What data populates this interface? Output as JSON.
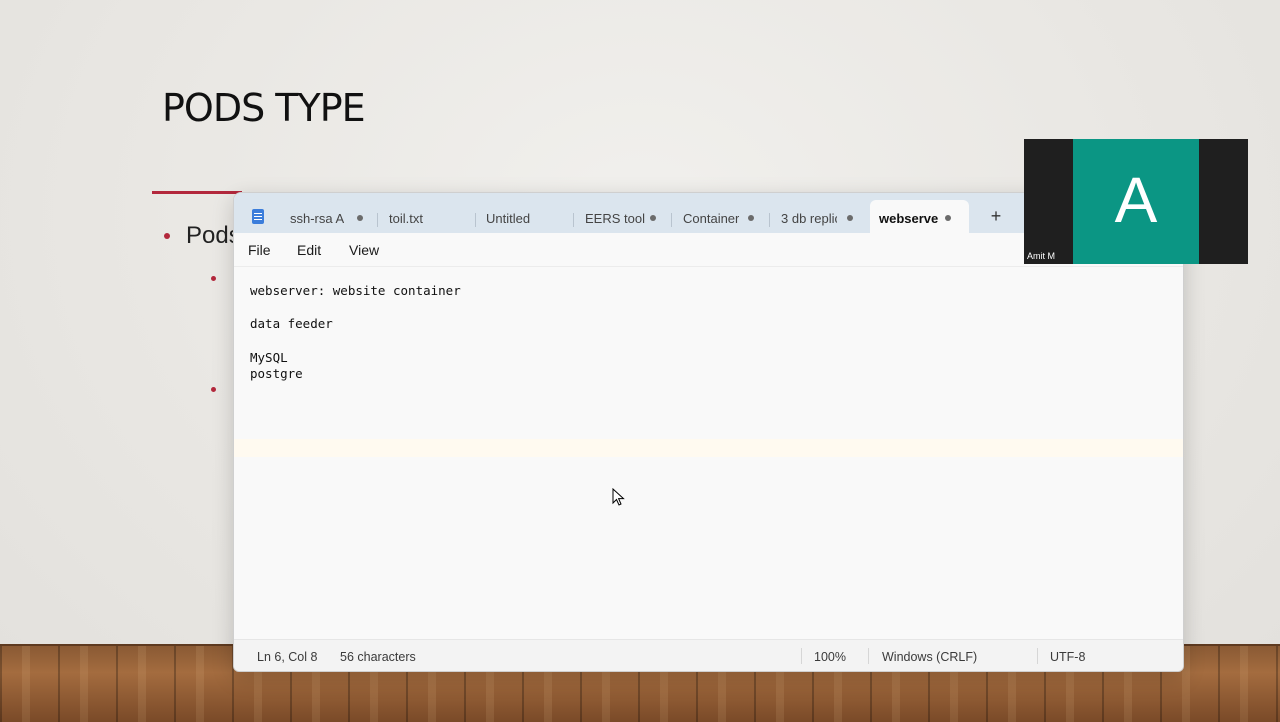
{
  "slide": {
    "title": "PODS TYPE",
    "bullet_text": "Pods"
  },
  "notepad": {
    "app_icon": "notepad-icon",
    "tabs": [
      {
        "label": "ssh-rsa AA",
        "modified": true
      },
      {
        "label": "toil.txt",
        "modified": false
      },
      {
        "label": "Untitled",
        "modified": false
      },
      {
        "label": "EERS  tool",
        "modified": true
      },
      {
        "label": "Container",
        "modified": true
      },
      {
        "label": "3 db replic",
        "modified": true
      },
      {
        "label": "webserve",
        "modified": true,
        "active": true
      }
    ],
    "new_tab": "+",
    "menu": {
      "file": "File",
      "edit": "Edit",
      "view": "View"
    },
    "lines": [
      "webserver: website container",
      "",
      "data feeder",
      "",
      "MySQL",
      "postgre"
    ],
    "status": {
      "position": "Ln 6, Col 8",
      "characters": "56 characters",
      "zoom": "100%",
      "line_ending": "Windows (CRLF)",
      "encoding": "UTF-8"
    }
  },
  "video": {
    "avatar_letter": "A",
    "participant_name": "Amit M",
    "avatar_color": "#0b9684"
  }
}
